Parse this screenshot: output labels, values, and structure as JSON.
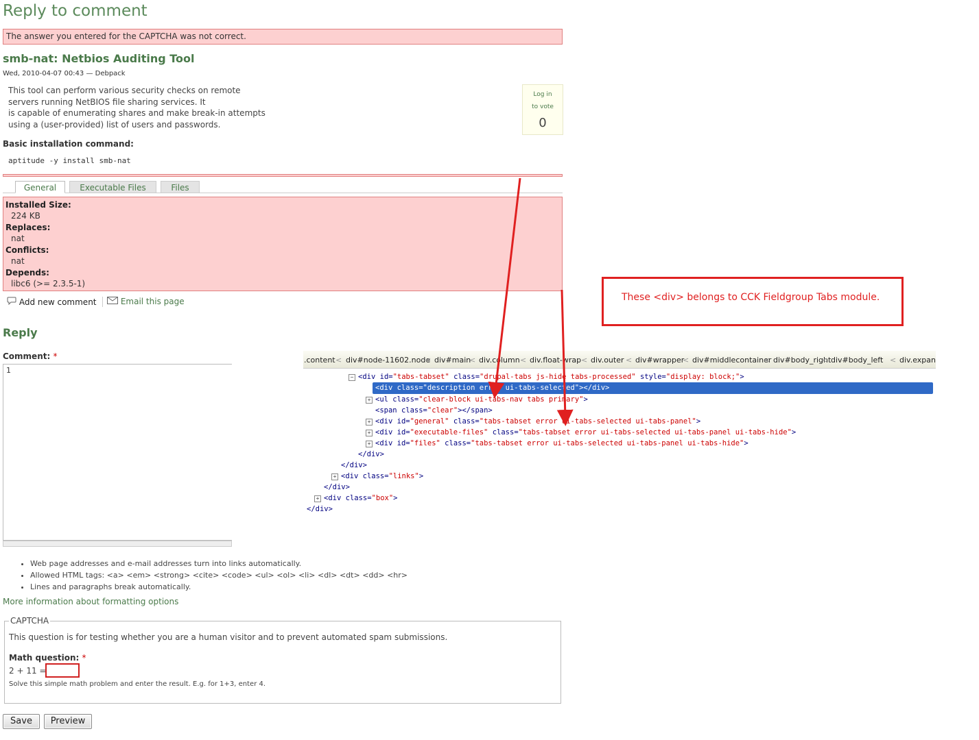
{
  "page": {
    "title": "Reply to comment",
    "error_message": "The answer you entered for the CAPTCHA was not correct."
  },
  "node": {
    "title": "smb-nat: Netbios Auditing Tool",
    "submitted": "Wed, 2010-04-07 00:43 — Debpack",
    "description": [
      "This tool can perform various security checks on remote",
      "servers running NetBIOS file sharing services. It",
      "is capable of enumerating shares and make break-in attempts",
      "using a (user-provided) list of users and passwords."
    ],
    "install_heading": "Basic installation command:",
    "install_command": "aptitude -y install smb-nat",
    "vote": {
      "line1": "Log in",
      "line2": "to vote",
      "count": "0"
    }
  },
  "tabs": [
    {
      "label": "General"
    },
    {
      "label": "Executable Files"
    },
    {
      "label": "Files"
    }
  ],
  "fields": {
    "installed_size_label": "Installed Size:",
    "installed_size": "224 KB",
    "replaces_label": "Replaces:",
    "replaces": "nat",
    "conflicts_label": "Conflicts:",
    "conflicts": "nat",
    "depends_label": "Depends:",
    "depends": "libc6 (>= 2.3.5-1)"
  },
  "links": {
    "add_comment": "Add new comment",
    "email_page": "Email this page"
  },
  "reply": {
    "heading": "Reply",
    "comment_label": "Comment:",
    "required_mark": "*",
    "comment_value": "1",
    "tips": [
      "Web page addresses and e-mail addresses turn into links automatically.",
      "Allowed HTML tags: <a> <em> <strong> <cite> <code> <ul> <ol> <li> <dl> <dt> <dd> <hr>",
      "Lines and paragraphs break automatically."
    ],
    "more_info": "More information about formatting options"
  },
  "captcha": {
    "legend": "CAPTCHA",
    "description": "This question is for testing whether you are a human visitor and to prevent automated spam submissions.",
    "math_label": "Math question:",
    "required_mark": "*",
    "question": "2 + 11 =",
    "answer": "",
    "help": "Solve this simple math problem and enter the result. E.g. for 1+3, enter 4."
  },
  "buttons": {
    "save": "Save",
    "preview": "Preview"
  },
  "annotation": {
    "note": "These <div> belongs to CCK Fieldgroup Tabs module.",
    "color": "#e02020"
  },
  "devtools": {
    "breadcrumbs": [
      ".content",
      "div#node-11602.node",
      "div#main",
      "div.column",
      "div.float-wrap",
      "div.outer",
      "div#wrapper",
      "div#middlecontainer",
      "div#body_right",
      "div#body_left",
      "div.expand"
    ],
    "lines": [
      {
        "pre": "<",
        "tag": "div",
        "a1": " id=",
        "v1": "\"tabs-tabset\"",
        "a2": " class=",
        "v2": "\"drupal-tabs js-hide tabs-processed\"",
        "a3": " style=",
        "v3": "\"display: block;\"",
        "post": ">"
      },
      {
        "text": "<div class=\"description error ui-tabs-selected\"></div>"
      },
      {
        "pre": "<",
        "tag": "ul",
        "a1": " class=",
        "v1": "\"clear-block ui-tabs-nav tabs primary\"",
        "post": ">"
      },
      {
        "pre": "<",
        "tag": "span",
        "a1": " class=",
        "v1": "\"clear\"",
        "post": "></span>"
      },
      {
        "pre": "<",
        "tag": "div",
        "a1": " id=",
        "v1": "\"general\"",
        "a2": " class=",
        "v2": "\"tabs-tabset error ui-tabs-selected ui-tabs-panel\"",
        "post": ">"
      },
      {
        "pre": "<",
        "tag": "div",
        "a1": " id=",
        "v1": "\"executable-files\"",
        "a2": " class=",
        "v2": "\"tabs-tabset error ui-tabs-selected ui-tabs-panel ui-tabs-hide\"",
        "post": ">"
      },
      {
        "pre": "<",
        "tag": "div",
        "a1": " id=",
        "v1": "\"files\"",
        "a2": " class=",
        "v2": "\"tabs-tabset error ui-tabs-selected ui-tabs-panel ui-tabs-hide\"",
        "post": ">"
      },
      {
        "text": "</div>"
      },
      {
        "text": "</div>"
      },
      {
        "pre": "<",
        "tag": "div",
        "a1": " class=",
        "v1": "\"links\"",
        "post": ">"
      },
      {
        "text": "</div>"
      },
      {
        "pre": "<",
        "tag": "div",
        "a1": " class=",
        "v1": "\"box\"",
        "post": ">"
      },
      {
        "text": "</div>"
      }
    ]
  }
}
